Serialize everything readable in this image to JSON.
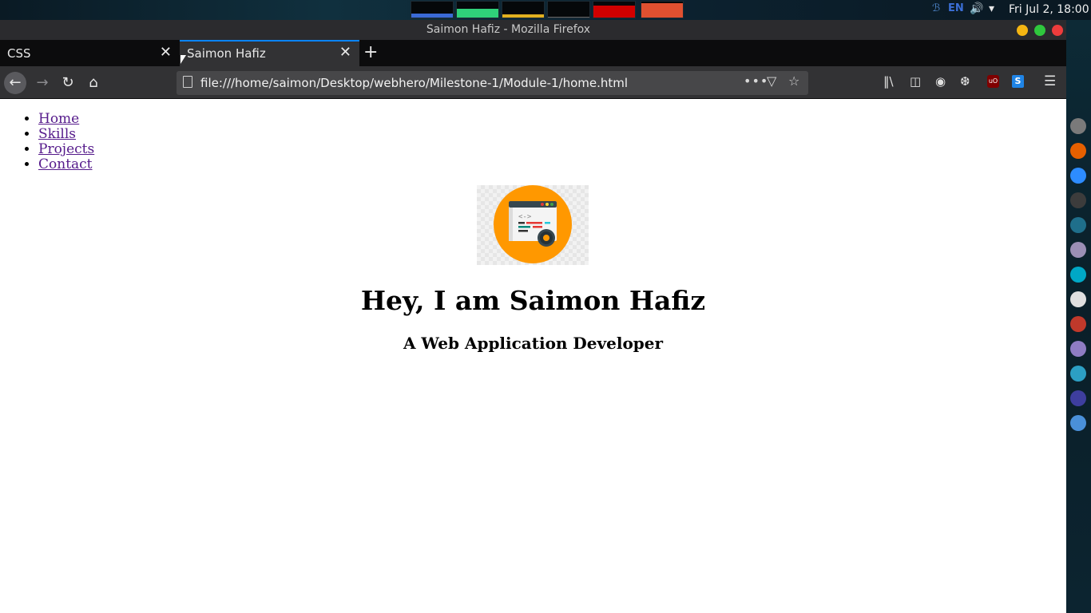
{
  "topbar": {
    "clock": "Fri Jul 2, 18:00",
    "language": "EN",
    "bluetooth_icon": "bluetooth-icon",
    "volume_icon": "volume-icon",
    "wifi_icon": "wifi-icon",
    "monitors": [
      {
        "name": "cpu-monitor",
        "color": "#3a6ad6",
        "level": 0.25
      },
      {
        "name": "memory-monitor",
        "color": "#2fd17a",
        "level": 0.55
      },
      {
        "name": "network-monitor",
        "color": "#e0b020",
        "level": 0.2
      },
      {
        "name": "swap-monitor",
        "color": "#666666",
        "level": 0.05
      },
      {
        "name": "load-monitor",
        "color": "#d00000",
        "level": 0.75
      },
      {
        "name": "disk-monitor",
        "color": "#e05030",
        "level": 0.9
      }
    ]
  },
  "window": {
    "title": "Saimon Hafiz - Mozilla Firefox"
  },
  "tabs": [
    {
      "label": "CSS",
      "active": false
    },
    {
      "label": "Saimon Hafiz",
      "active": true
    }
  ],
  "toolbar": {
    "url": "file:///home/saimon/Desktop/webhero/Milestone-1/Module-1/home.html",
    "back_icon": "←",
    "forward_icon": "→",
    "reload_icon": "↻",
    "home_icon": "⌂",
    "more_icon": "•••",
    "pocket_icon": "▽",
    "star_icon": "☆",
    "library_icon": "‖\\",
    "sidebar_icon": "◫",
    "account_icon": "◉",
    "ext_icon": "❆",
    "ublock_label": "uO",
    "s_ext_label": "S",
    "menu_icon": "☰",
    "close_icon": "✕",
    "new_tab_icon": "+"
  },
  "page": {
    "nav": [
      "Home",
      "Skills",
      "Projects",
      "Contact"
    ],
    "heading": "Hey, I am Saimon Hafiz",
    "subheading": "A Web Application Developer"
  },
  "dock": {
    "apps": [
      {
        "name": "settings-dock-icon",
        "color": "#7a7a7a"
      },
      {
        "name": "firefox-dock-icon",
        "color": "#e66000"
      },
      {
        "name": "zoom-dock-icon",
        "color": "#2d8cff"
      },
      {
        "name": "terminal-dock-icon",
        "color": "#3c3c3c"
      },
      {
        "name": "network-dock-icon",
        "color": "#1f6f8b"
      },
      {
        "name": "camera-dock-icon",
        "color": "#9b8fb5"
      },
      {
        "name": "monitor-dock-icon",
        "color": "#00a8c6"
      },
      {
        "name": "kde-dock-icon",
        "color": "#e0e0e0"
      },
      {
        "name": "terminal-red-dock-icon",
        "color": "#c0392b"
      },
      {
        "name": "document-dock-icon",
        "color": "#8e7cc3"
      },
      {
        "name": "bird-dock-icon",
        "color": "#2c9fc4"
      },
      {
        "name": "vscode-dock-icon",
        "color": "#3e3e9e"
      },
      {
        "name": "chrome-dock-icon",
        "color": "#4a90d9"
      }
    ]
  }
}
